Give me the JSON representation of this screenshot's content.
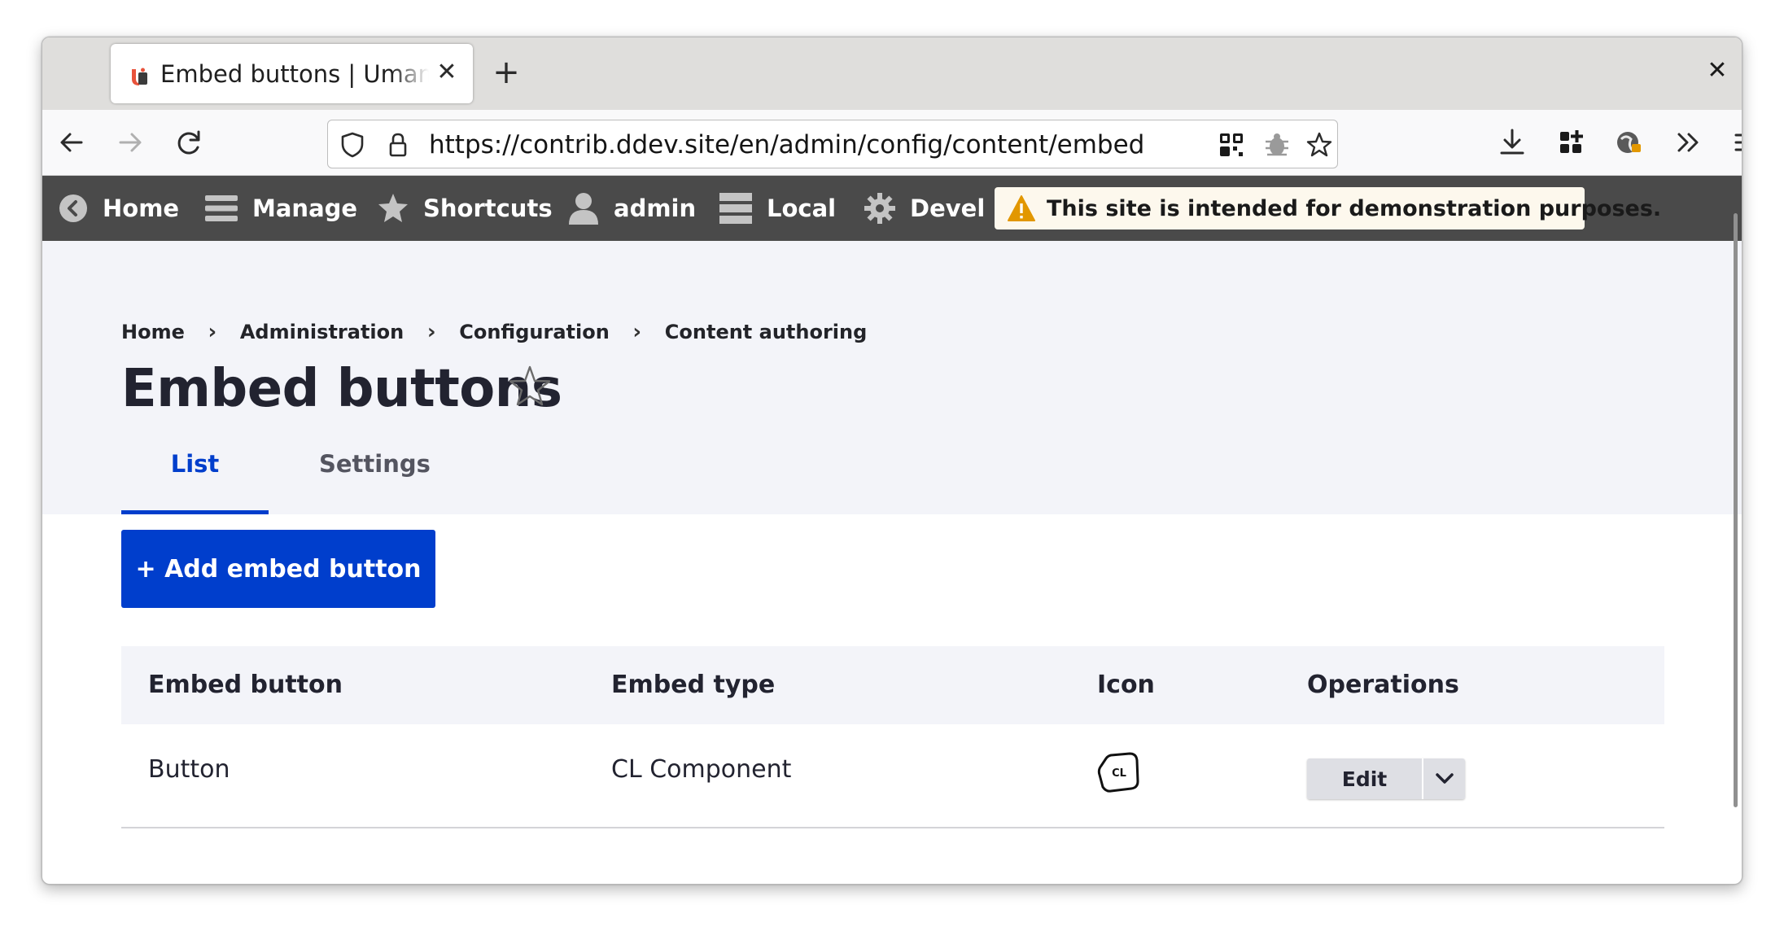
{
  "browser": {
    "tab_title": "Embed buttons | Umami Food Magazine",
    "url": "https://contrib.ddev.site/en/admin/config/content/embed"
  },
  "toolbar": {
    "items": [
      {
        "label": "Home",
        "icon": "back-circle-icon"
      },
      {
        "label": "Manage",
        "icon": "hamburger-icon"
      },
      {
        "label": "Shortcuts",
        "icon": "star-icon"
      },
      {
        "label": "admin",
        "icon": "user-icon"
      },
      {
        "label": "Local",
        "icon": "server-icon"
      },
      {
        "label": "Devel",
        "icon": "gear-icon"
      }
    ],
    "banner": "This site is intended for demonstration purposes."
  },
  "breadcrumb": [
    "Home",
    "Administration",
    "Configuration",
    "Content authoring"
  ],
  "page": {
    "title": "Embed buttons",
    "tabs": {
      "list": "List",
      "settings": "Settings"
    },
    "add_button": "+ Add embed button"
  },
  "table": {
    "headers": [
      "Embed button",
      "Embed type",
      "Icon",
      "Operations"
    ],
    "rows": [
      {
        "embed_button": "Button",
        "embed_type": "CL Component",
        "icon_text": "CL",
        "operation": "Edit"
      }
    ]
  },
  "colors": {
    "accent": "#003ecc",
    "toolbar_bg": "#4a4a4a",
    "header_bg": "#f3f4f9",
    "warning": "#e29700"
  }
}
